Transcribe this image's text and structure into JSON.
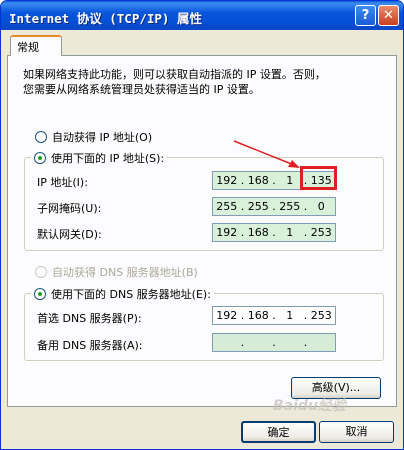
{
  "window": {
    "title": "Internet 协议 (TCP/IP) 属性",
    "help_icon": "?",
    "close_icon": "✕"
  },
  "tabs": [
    {
      "label": "常规",
      "active": true
    }
  ],
  "description": [
    "如果网络支持此功能，则可以获取自动指派的 IP 设置。否则，",
    "您需要从网络系统管理员处获得适当的 IP 设置。"
  ],
  "ip_mode": {
    "auto_label": "自动获得 IP 地址(O)",
    "manual_label": "使用下面的 IP 地址(S):",
    "selected": "manual"
  },
  "ip_fields": [
    {
      "label": "IP 地址(I):",
      "octets": [
        "192",
        "168",
        "1",
        "135"
      ]
    },
    {
      "label": "子网掩码(U):",
      "octets": [
        "255",
        "255",
        "255",
        "0"
      ]
    },
    {
      "label": "默认网关(D):",
      "octets": [
        "192",
        "168",
        "1",
        "253"
      ]
    }
  ],
  "dns_mode": {
    "auto_label": "自动获得 DNS 服务器地址(B)",
    "manual_label": "使用下面的 DNS 服务器地址(E):",
    "selected": "manual",
    "auto_disabled": true
  },
  "dns_fields": [
    {
      "label": "首选 DNS 服务器(P):",
      "octets": [
        "192",
        "168",
        "1",
        "253"
      ]
    },
    {
      "label": "备用 DNS 服务器(A):",
      "octets": [
        "",
        "",
        "",
        ""
      ]
    }
  ],
  "buttons": {
    "advanced": "高级(V)...",
    "ok": "确定",
    "cancel": "取消"
  },
  "annotation": {
    "highlight_color": "#e02020"
  },
  "watermark": "Baidu经验"
}
